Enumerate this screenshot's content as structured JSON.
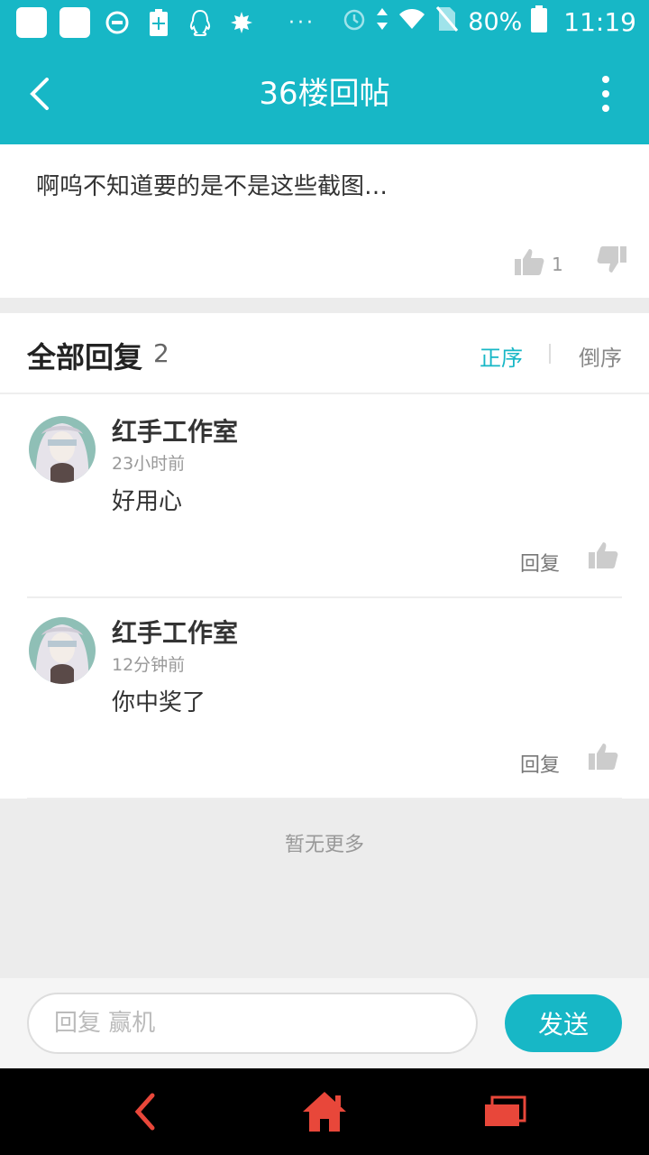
{
  "status_bar": {
    "battery_percent": "80%",
    "time": "11:19",
    "icons": [
      "app-square-icon",
      "app-square-icon",
      "dnd-icon",
      "battery-plus-icon",
      "qq-icon",
      "maple-leaf-icon",
      "more-dots-icon",
      "alarm-icon",
      "data-arrows-icon",
      "wifi-icon",
      "no-sim-icon",
      "battery-icon"
    ]
  },
  "header": {
    "title": "36楼回帖",
    "icons": {
      "back": "back-arrow-icon",
      "more": "more-vertical-icon"
    }
  },
  "post": {
    "text": "啊呜不知道要的是不是这些截图…",
    "like_count": "1"
  },
  "replies": {
    "title": "全部回复",
    "count": "2",
    "sort_asc": "正序",
    "sort_desc": "倒序",
    "items": [
      {
        "name": "红手工作室",
        "time": "23小时前",
        "content": "好用心",
        "reply_label": "回复"
      },
      {
        "name": "红手工作室",
        "time": "12分钟前",
        "content": "你中奖了",
        "reply_label": "回复"
      }
    ],
    "no_more": "暂无更多"
  },
  "input": {
    "placeholder": "回复 赢机",
    "send_label": "发送"
  },
  "colors": {
    "accent": "#17b7c6",
    "nav_icons": "#e8473a"
  }
}
